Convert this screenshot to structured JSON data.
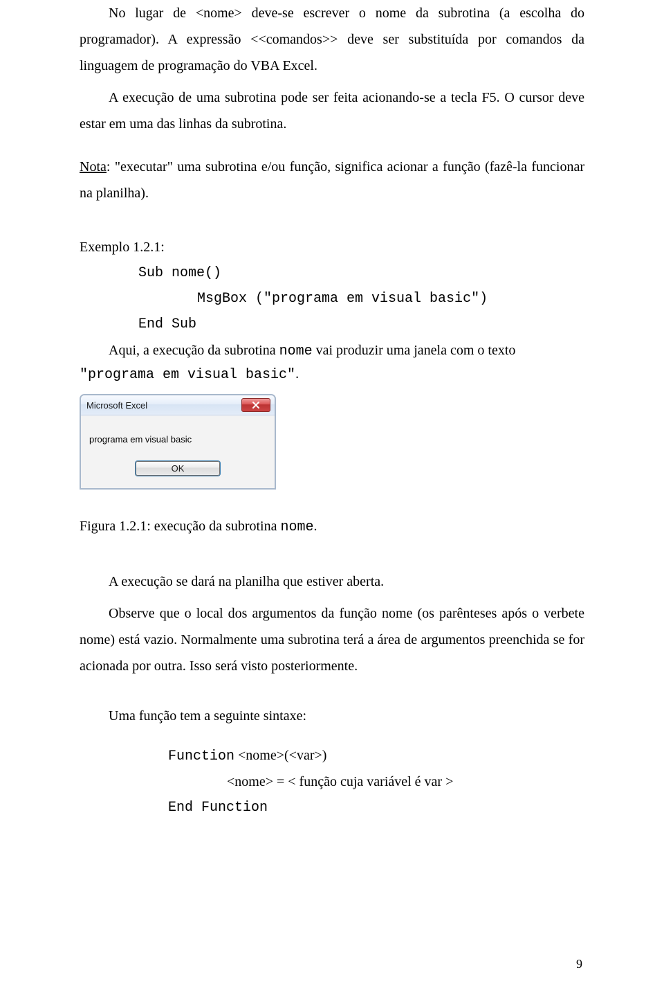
{
  "paragraph1": "No lugar de <nome> deve-se escrever o nome da subrotina (a escolha do programador). A expressão <<comandos>> deve ser substituída por comandos da linguagem de programação do VBA Excel.",
  "paragraph2": "A execução de uma subrotina pode ser feita acionando-se a tecla F5. O cursor deve estar em uma das linhas da subrotina.",
  "nota": {
    "label": "Nota",
    "text": ": \"executar\" uma subrotina e/ou função, significa acionar a função (fazê-la funcionar na planilha)."
  },
  "exemplo_heading": "Exemplo 1.2.1:",
  "code_example": {
    "l1": "Sub nome()",
    "l2": "MsgBox (\"programa em visual basic\")",
    "l3": "End Sub"
  },
  "mixed_para": {
    "pre": "Aqui, a execução da subrotina ",
    "code1": "nome",
    "mid": " vai produzir uma janela com o texto ",
    "code2": "\"programa em visual basic\"",
    "post": "."
  },
  "dialog": {
    "title": "Microsoft Excel",
    "message": "programa em visual basic",
    "ok_label": "OK"
  },
  "caption": {
    "pre": "Figura 1.2.1: execução da subrotina ",
    "code": "nome",
    "post": "."
  },
  "paragraph3": "A execução se dará na planilha que estiver aberta.",
  "paragraph4": "Observe que o local dos argumentos da função nome (os parênteses após o verbete nome) está vazio. Normalmente uma subrotina terá a área de argumentos preenchida se for acionada por outra. Isso será visto posteriormente.",
  "syntax_heading": "Uma função tem a seguinte sintaxe:",
  "syntax": {
    "l1_code": "Function",
    "l1_rest": " <nome>(<var>)",
    "l2": "<nome> = < função cuja variável é var >",
    "l3": "End Function"
  },
  "page_number": "9"
}
